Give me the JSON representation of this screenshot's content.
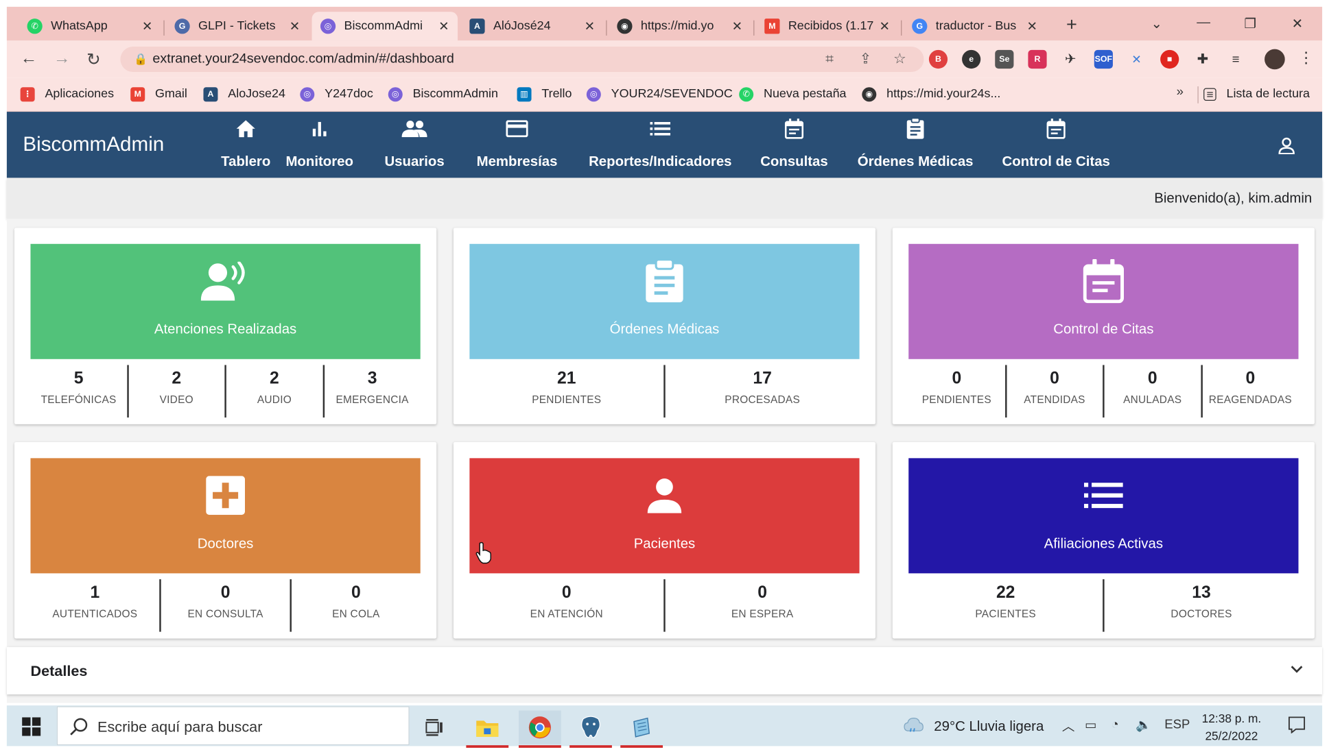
{
  "browser": {
    "tabs": [
      {
        "label": "WhatsApp",
        "icon": "whatsapp-icon",
        "color": "#25d366"
      },
      {
        "label": "GLPI - Tickets",
        "icon": "glpi-icon",
        "color": "#4e6aa8"
      },
      {
        "label": "BiscommAdmi",
        "icon": "biscomm-icon",
        "color": "#7b62d8",
        "active": true
      },
      {
        "label": "AlóJosé24",
        "icon": "alojose-icon",
        "color": "#294e75"
      },
      {
        "label": "https://mid.yo",
        "icon": "globe-icon",
        "color": "#333333"
      },
      {
        "label": "Recibidos (1.17",
        "icon": "gmail-icon",
        "color": "#ea4335"
      },
      {
        "label": "traductor - Bus",
        "icon": "google-icon",
        "color": "#4285f4"
      }
    ],
    "url": "extranet.your24sevendoc.com/admin/#/dashboard",
    "bookmarks": [
      {
        "label": "Aplicaciones",
        "icon": "apps-grid-icon",
        "color": "#e8453c"
      },
      {
        "label": "Gmail",
        "icon": "gmail-icon",
        "color": "#ea4335"
      },
      {
        "label": "AloJose24",
        "icon": "alojose-icon",
        "color": "#294e75"
      },
      {
        "label": "Y247doc",
        "icon": "y247doc-icon",
        "color": "#7b62d8"
      },
      {
        "label": "BiscommAdmin",
        "icon": "biscomm-icon",
        "color": "#7b62d8"
      },
      {
        "label": "Trello",
        "icon": "trello-icon",
        "color": "#0079bf"
      },
      {
        "label": "YOUR24/SEVENDOC",
        "icon": "your24-icon",
        "color": "#7b62d8"
      },
      {
        "label": "Nueva pestaña",
        "icon": "whatsapp-icon",
        "color": "#25d366"
      },
      {
        "label": "https://mid.your24s...",
        "icon": "globe-icon",
        "color": "#333333"
      }
    ],
    "bookmarks_more": "»",
    "reading_list": "Lista de lectura"
  },
  "app": {
    "brand": "BiscommAdmin",
    "nav": [
      {
        "label": "Tablero",
        "icon": "home-icon"
      },
      {
        "label": "Monitoreo",
        "icon": "bar-chart-icon"
      },
      {
        "label": "Usuarios",
        "icon": "users-icon"
      },
      {
        "label": "Membresías",
        "icon": "credit-card-icon"
      },
      {
        "label": "Reportes/Indicadores",
        "icon": "list-icon"
      },
      {
        "label": "Consultas",
        "icon": "calendar-icon"
      },
      {
        "label": "Órdenes Médicas",
        "icon": "clipboard-icon"
      },
      {
        "label": "Control de Citas",
        "icon": "calendar-icon"
      }
    ],
    "welcome": "Bienvenido(a), kim.admin"
  },
  "dashboard": {
    "cards": [
      {
        "title": "Atenciones Realizadas",
        "color": "#52c27a",
        "icon": "speaking-person-icon",
        "stats": [
          {
            "value": "5",
            "label": "TELEFÓNICAS"
          },
          {
            "value": "2",
            "label": "VIDEO"
          },
          {
            "value": "2",
            "label": "AUDIO"
          },
          {
            "value": "3",
            "label": "EMERGENCIA"
          }
        ]
      },
      {
        "title": "Órdenes Médicas",
        "color": "#7ec7e1",
        "icon": "clipboard-icon",
        "stats": [
          {
            "value": "21",
            "label": "PENDIENTES"
          },
          {
            "value": "17",
            "label": "PROCESADAS"
          }
        ]
      },
      {
        "title": "Control de Citas",
        "color": "#b56cc3",
        "icon": "calendar-icon",
        "stats": [
          {
            "value": "0",
            "label": "PENDIENTES"
          },
          {
            "value": "0",
            "label": "ATENDIDAS"
          },
          {
            "value": "0",
            "label": "ANULADAS"
          },
          {
            "value": "0",
            "label": "REAGENDADAS"
          }
        ]
      },
      {
        "title": "Doctores",
        "color": "#d98540",
        "icon": "medical-cross-icon",
        "stats": [
          {
            "value": "1",
            "label": "AUTENTICADOS"
          },
          {
            "value": "0",
            "label": "EN CONSULTA"
          },
          {
            "value": "0",
            "label": "EN COLA"
          }
        ]
      },
      {
        "title": "Pacientes",
        "color": "#dc3c3c",
        "icon": "person-icon",
        "stats": [
          {
            "value": "0",
            "label": "EN ATENCIÓN"
          },
          {
            "value": "0",
            "label": "EN ESPERA"
          }
        ]
      },
      {
        "title": "Afiliaciones Activas",
        "color": "#2317a7",
        "icon": "list-icon",
        "stats": [
          {
            "value": "22",
            "label": "PACIENTES"
          },
          {
            "value": "13",
            "label": "DOCTORES"
          }
        ]
      }
    ],
    "details_label": "Detalles"
  },
  "taskbar": {
    "search_placeholder": "Escribe aquí para buscar",
    "weather": "29°C  Lluvia ligera",
    "lang": "ESP",
    "time": "12:38 p. m.",
    "date": "25/2/2022"
  }
}
